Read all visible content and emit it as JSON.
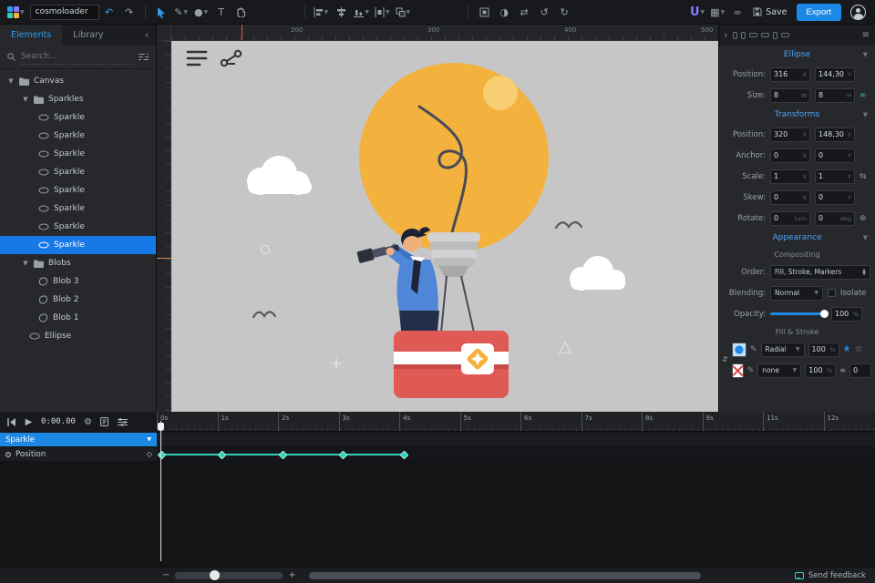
{
  "topbar": {
    "project_name": "cosmoloader",
    "text_tool_glyph": "T",
    "brand_glyph": "U",
    "save_label": "Save",
    "export_label": "Export"
  },
  "left_panel": {
    "tabs": [
      {
        "label": "Elements",
        "active": true
      },
      {
        "label": "Library",
        "active": false
      }
    ],
    "search": {
      "placeholder": "Search..."
    },
    "tree": [
      {
        "label": "Canvas",
        "icon": "folder",
        "depth": 0
      },
      {
        "label": "Sparkles",
        "icon": "folder",
        "depth": 1
      },
      {
        "label": "Sparkle",
        "icon": "ellipse",
        "depth": 2
      },
      {
        "label": "Sparkle",
        "icon": "ellipse",
        "depth": 2
      },
      {
        "label": "Sparkle",
        "icon": "ellipse",
        "depth": 2
      },
      {
        "label": "Sparkle",
        "icon": "ellipse",
        "depth": 2
      },
      {
        "label": "Sparkle",
        "icon": "ellipse",
        "depth": 2
      },
      {
        "label": "Sparkle",
        "icon": "ellipse",
        "depth": 2
      },
      {
        "label": "Sparkle",
        "icon": "ellipse",
        "depth": 2
      },
      {
        "label": "Sparkle",
        "icon": "ellipse",
        "depth": 2,
        "selected": true
      },
      {
        "label": "Blobs",
        "icon": "folder",
        "depth": 1
      },
      {
        "label": "Blob 3",
        "icon": "blob",
        "depth": 2
      },
      {
        "label": "Blob 2",
        "icon": "blob",
        "depth": 2
      },
      {
        "label": "Blob 1",
        "icon": "blob",
        "depth": 2
      },
      {
        "label": "Ellipse",
        "icon": "ellipse",
        "depth": 1
      }
    ]
  },
  "canvas": {
    "ruler_h_labels": [
      "200",
      "300",
      "400",
      "500"
    ]
  },
  "right_panel": {
    "ellipse_section": {
      "title": "Ellipse",
      "position_label": "Position:",
      "position_x": "316",
      "unit_x": "X",
      "position_y": "144,30",
      "unit_y": "Y",
      "size_label": "Size:",
      "size_w": "8",
      "unit_w": "W",
      "size_h": "8",
      "unit_h": "H"
    },
    "transforms_section": {
      "title": "Transforms",
      "rows": [
        {
          "label": "Position:",
          "v1": "320",
          "u1": "X",
          "v2": "148,30",
          "u2": "Y"
        },
        {
          "label": "Anchor:",
          "v1": "0",
          "u1": "X",
          "v2": "0",
          "u2": "Y"
        },
        {
          "label": "Scale:",
          "v1": "1",
          "u1": "X",
          "v2": "1",
          "u2": "Y"
        },
        {
          "label": "Skew:",
          "v1": "0",
          "u1": "X",
          "v2": "0",
          "u2": "Y"
        },
        {
          "label": "Rotate:",
          "v1": "0",
          "u1": "turn",
          "v2": "0",
          "u2": "deg"
        }
      ]
    },
    "appearance_section": {
      "title": "Appearance",
      "compositing_label": "Compositing",
      "order_label": "Order:",
      "order_value": "Fill, Stroke, Markers",
      "blending_label": "Blending:",
      "blending_value": "Normal",
      "isolate_label": "Isolate",
      "opacity_label": "Opacity:",
      "opacity_value": "100",
      "opacity_unit": "%",
      "fill_stroke_label": "Fill & Stroke",
      "fill_row": {
        "type": "Radial",
        "opacity": "100",
        "unit": "%"
      },
      "stroke_row": {
        "type": "none",
        "opacity": "100",
        "unit": "%",
        "width": "0"
      }
    }
  },
  "timeline": {
    "time_display": "0:00.00",
    "ruler_labels": [
      "0s",
      "1s",
      "2s",
      "3s",
      "4s",
      "5s",
      "6s",
      "7s",
      "8s",
      "9s",
      "11s",
      "12s"
    ],
    "track": {
      "name": "Sparkle"
    },
    "property": {
      "name": "Position"
    },
    "keyframes_sec": [
      0,
      1,
      2,
      3,
      4
    ]
  },
  "statusbar": {
    "zoom_out_glyph": "−",
    "zoom_in_glyph": "+",
    "feedback_label": "Send feedback"
  },
  "colors": {
    "accent": "#1e88e5",
    "section_title": "#4da3f7",
    "selection": "#1778e8",
    "keyframe_teal": "#35d0ba",
    "canvas_bg": "#c6c6c6",
    "bulb_orange": "#f3b13e",
    "basket_red": "#e05a55",
    "shirt_blue": "#4f86d8"
  }
}
